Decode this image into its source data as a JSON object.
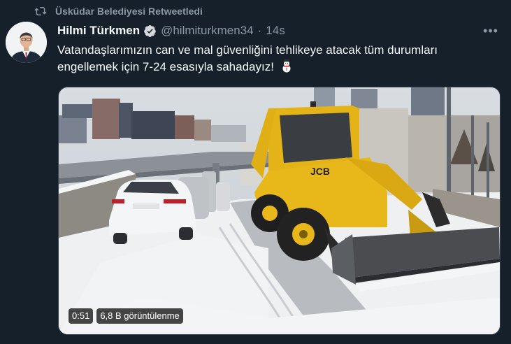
{
  "retweet": {
    "icon": "retweet-icon",
    "label": "Üsküdar Belediyesi Retweetledi"
  },
  "tweet": {
    "author_name": "Hilmi Türkmen",
    "verified_icon": "verified-badge-icon",
    "handle": "@hilmiturkmen34",
    "separator": "·",
    "time": "14s",
    "more_icon": "more-options-icon",
    "text": "Vatandaşlarımızın can ve mal güvenliğini tehlikeye atacak tüm durumları engellemek için 7-24 esasıyla sahadayız!",
    "text_emoji_icon": "snowman-icon"
  },
  "video": {
    "duration": "0:51",
    "views": "6,8 B görüntülenme"
  },
  "colors": {
    "background": "#15202b",
    "secondary_text": "#8b98a5",
    "verified": "#1d9bf0",
    "border": "#38444d"
  }
}
